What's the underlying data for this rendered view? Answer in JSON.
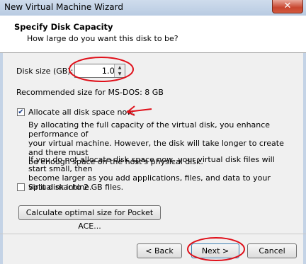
{
  "window": {
    "title": "New Virtual Machine Wizard",
    "close_glyph": "✕"
  },
  "header": {
    "title": "Specify Disk Capacity",
    "subtitle": "How large do you want this disk to be?"
  },
  "disk_size": {
    "label": "Disk size (GB):",
    "value": "1.0",
    "up_glyph": "▲",
    "down_glyph": "▼"
  },
  "recommended": "Recommended size for MS-DOS: 8 GB",
  "allocate": {
    "label": "Allocate all disk space now.",
    "checked": true,
    "check_glyph": "✔",
    "description_1_lines": [
      "By allocating the full capacity of the virtual disk, you enhance performance of",
      "your virtual machine.  However, the disk will take longer to create and there must",
      "be enough space on the host's physical disk."
    ],
    "description_2_lines": [
      "If you do not allocate disk space now, your virtual disk files will start small, then",
      "become larger as you add applications, files, and data to your virtual machine."
    ]
  },
  "split": {
    "label": "Split disk into 2 GB files.",
    "checked": false
  },
  "calc_button": "Calculate optimal size for Pocket ACE...",
  "footer": {
    "back": "< Back",
    "next": "Next >",
    "cancel": "Cancel"
  },
  "annotation_color": "#e0101a"
}
